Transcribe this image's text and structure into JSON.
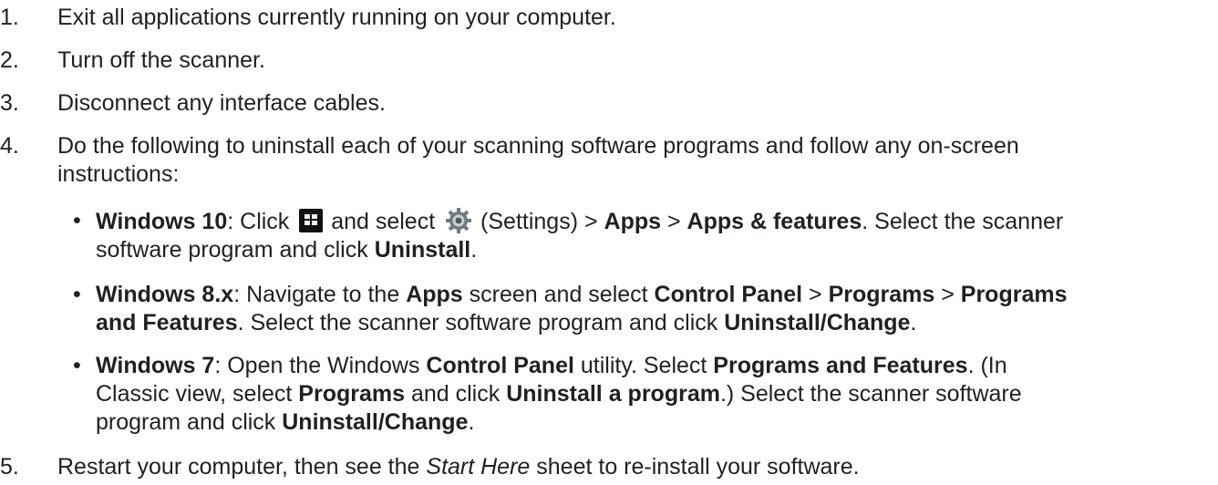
{
  "steps": [
    {
      "num": "1.",
      "text": "Exit all applications currently running on your computer."
    },
    {
      "num": "2.",
      "text": "Turn off the scanner."
    },
    {
      "num": "3.",
      "text": "Disconnect any interface cables."
    },
    {
      "num": "4.",
      "text_line1": "Do the following to uninstall each of your scanning software programs and follow any on-screen",
      "text_line2": "instructions:"
    },
    {
      "num": "5.",
      "text_a": "Restart your computer, then see the ",
      "text_italic": "Start Here",
      "text_b": " sheet to re-install your software."
    }
  ],
  "bullet_char": "•",
  "bullets": {
    "win10": {
      "os": "Windows 10",
      "p1": ": Click ",
      "p2": " and select ",
      "p3": " (Settings) > ",
      "b1": "Apps",
      "p4": " > ",
      "b2": "Apps & features",
      "p5": ". Select the scanner",
      "p6": "software program and click ",
      "b3": "Uninstall",
      "p7": "."
    },
    "win8": {
      "os": "Windows 8.x",
      "p1": ": Navigate to the ",
      "b1": "Apps",
      "p2": " screen and select ",
      "b2": "Control Panel",
      "p3": " > ",
      "b3": "Programs",
      "p4": " > ",
      "b4": "Programs",
      "b5": "and Features",
      "p5": ". Select the scanner software program and click ",
      "b6": "Uninstall/Change",
      "p6": "."
    },
    "win7": {
      "os": "Windows 7",
      "p1": ": Open the Windows ",
      "b1": "Control Panel",
      "p2": " utility. Select ",
      "b2": "Programs and Features",
      "p3": ". (In",
      "p4": "Classic view, select ",
      "b3": "Programs",
      "p5": " and click ",
      "b4": "Uninstall a program",
      "p6": ".) Select the scanner software",
      "p7": "program and click ",
      "b5": "Uninstall/Change",
      "p8": "."
    }
  },
  "icons": {
    "windows_start": "windows-start-icon",
    "settings": "gear-icon"
  }
}
